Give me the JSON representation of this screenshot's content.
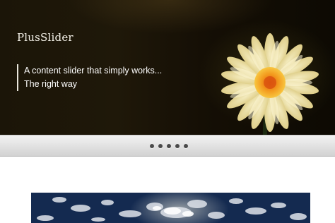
{
  "slider": {
    "title": "PlusSlider",
    "caption_line1": "A content slider that simply works...",
    "caption_line2": "The right way",
    "background_color": "#1b1508",
    "flower_petal_color": "#f7e9a8",
    "flower_center_color": "#f08a1c"
  },
  "pager": {
    "dot_count": 5,
    "dot_color": "#4a4a4a"
  },
  "second_slide": {
    "sky_color": "#18305a",
    "cloud_color": "#e8e4d8"
  }
}
